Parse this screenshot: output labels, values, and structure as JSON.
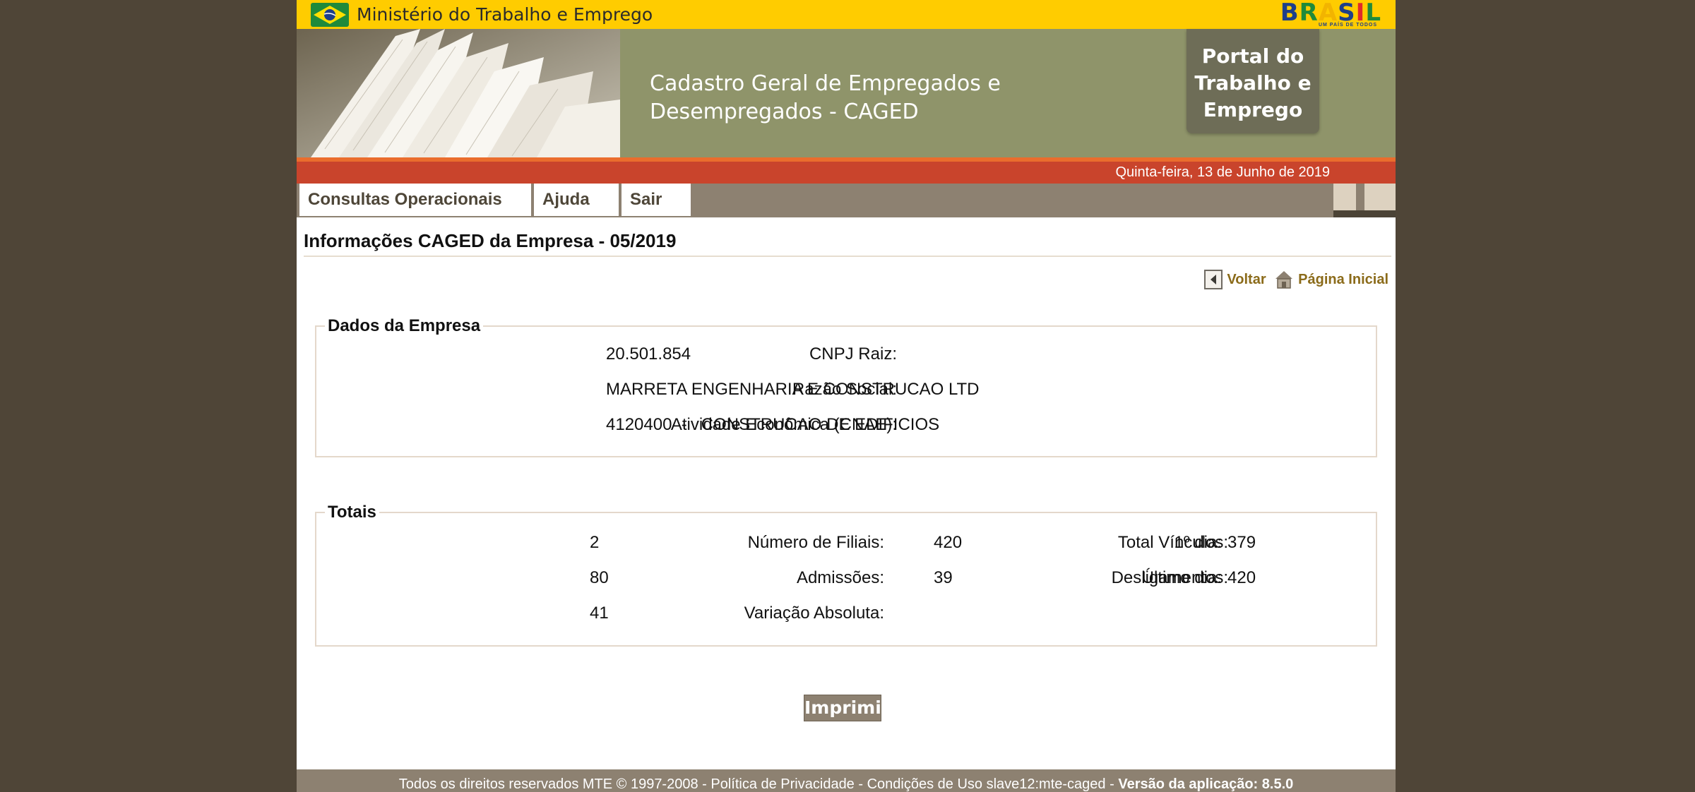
{
  "header": {
    "ministry_name": "Ministério do Trabalho e Emprego",
    "brasil_logo": "BRASIL",
    "brasil_tagline": "UM PAÍS DE TODOS",
    "banner_title": "Cadastro Geral de Empregados e Desempregados - CAGED",
    "portal_badge": [
      "Portal do",
      "Trabalho e",
      "Emprego"
    ],
    "date": "Quinta-feira, 13 de Junho de 2019",
    "brand_colors": {
      "yellow": "#ffcc00",
      "olive": "#8f946a",
      "orange": "#c9442c",
      "brown": "#8d8171"
    }
  },
  "nav": {
    "tabs": [
      "Consultas Operacionais",
      "Ajuda",
      "Sair"
    ]
  },
  "main": {
    "title": "Informações CAGED da Empresa - 05/2019",
    "links": {
      "back": "Voltar",
      "home": "Página Inicial"
    },
    "empresa": {
      "legend": "Dados da Empresa",
      "cnpj_label": "CNPJ Raiz:",
      "cnpj_value": "20.501.854",
      "razao_label": "Razão Social:",
      "razao_value": "MARRETA ENGENHARIA E CONSTRUCAO LTD",
      "cnae_label": "Atividade Econômica (CNAE):",
      "cnae_value": "4120400  -   CONSTRUCAO DE EDIFICIOS"
    },
    "totais": {
      "legend": "Totais",
      "filiais_label": "Número de Filiais:",
      "filiais_value": "2",
      "vinculos_label": "Total Vínculos:",
      "vinculos_value": "420",
      "primeiro_label": "1º dia:",
      "primeiro_value": "379",
      "admissoes_label": "Admissões:",
      "admissoes_value": "80",
      "desligamentos_label": "Desligamentos:",
      "desligamentos_value": "39",
      "ultimo_label": "Último dia:",
      "ultimo_value": "420",
      "variacao_label": "Variação Absoluta:",
      "variacao_value": "41"
    },
    "print_label": "Imprimir"
  },
  "footer": {
    "text": "Todos os direitos reservados MTE © 1997-2008 - Política de Privacidade - Condições de Uso slave12:mte-caged - ",
    "version": "Versão da aplicação: 8.5.0"
  }
}
